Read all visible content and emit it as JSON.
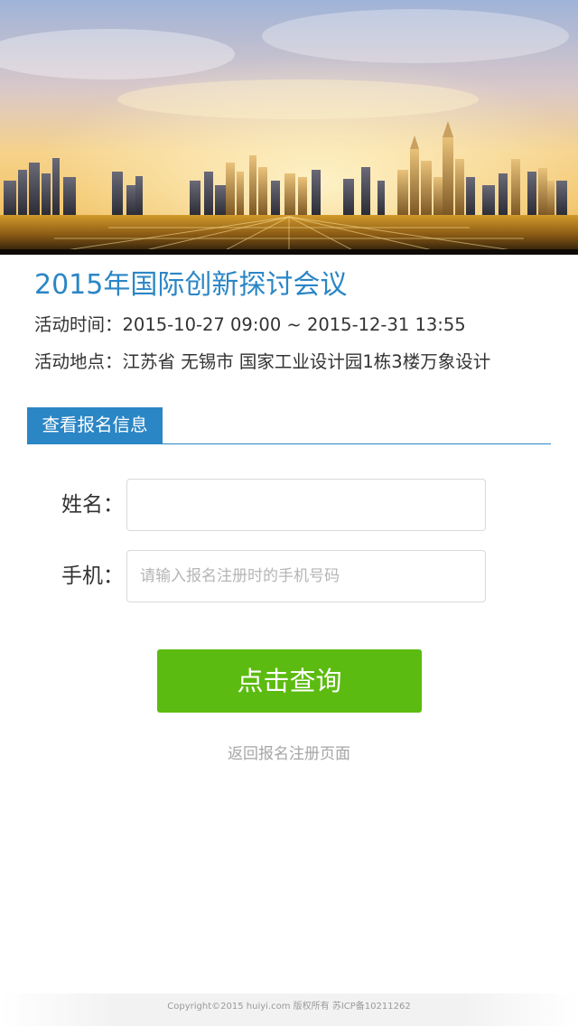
{
  "event": {
    "title": "2015年国际创新探讨会议",
    "time_line": "活动时间：2015-10-27 09:00 ~ 2015-12-31 13:55",
    "place_line": "活动地点：江苏省 无锡市 国家工业设计园1栋3楼万象设计"
  },
  "section": {
    "tab_label": "查看报名信息"
  },
  "form": {
    "name_label": "姓名：",
    "name_value": "",
    "phone_label": "手机：",
    "phone_placeholder": "请输入报名注册时的手机号码",
    "submit_label": "点击查询"
  },
  "links": {
    "back_label": "返回报名注册页面"
  },
  "footer": {
    "copyright": "Copyright©2015 huiyi.com 版权所有 苏ICP备10211262"
  },
  "colors": {
    "accent_blue": "#2b86c5",
    "button_green": "#5cbb10",
    "muted_text": "#a6a6a6"
  }
}
